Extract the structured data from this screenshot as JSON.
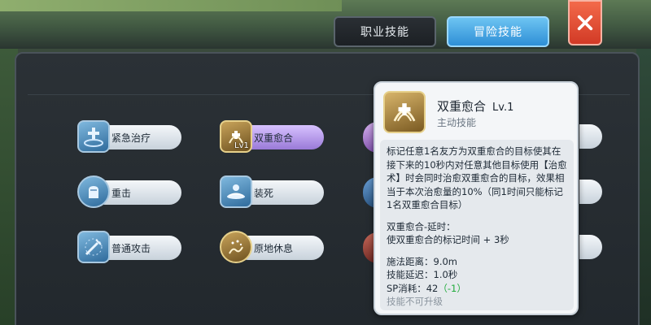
{
  "tabs": {
    "job": "职业技能",
    "adventure": "冒险技能"
  },
  "skills": [
    {
      "name": "紧急治疗",
      "icon": "shrine-icon"
    },
    {
      "name": "双重愈合",
      "icon": "double-heal-icon",
      "level": "Lv1",
      "selected": true
    },
    {
      "name": "重击",
      "icon": "fist-icon"
    },
    {
      "name": "装死",
      "icon": "play-dead-icon"
    },
    {
      "name": "普通攻击",
      "icon": "sword-icon"
    },
    {
      "name": "原地休息",
      "icon": "rest-icon"
    }
  ],
  "tooltip": {
    "title": "双重愈合",
    "level": "Lv.1",
    "type": "主动技能",
    "description": "标记任意1名友方为双重愈合的目标使其在接下来的10秒内对任意其他目标使用【治愈术】时会同时治愈双重愈合的目标，效果相当于本次治愈量的10%（同1时间只能标记1名双重愈合目标）",
    "delay_title": "双重愈合-延时：",
    "delay_text": "使双重愈合的标记时间 + 3秒",
    "range": "施法距离：9.0m",
    "cast_delay": "技能延迟：1.0秒",
    "sp_label": "SP消耗：42",
    "sp_delta": "（-1）",
    "footer": "技能不可升级"
  },
  "colors": {
    "tab_active": "#2e8fd6",
    "close_button": "#d23a26",
    "sp_delta": "#1faa3a"
  }
}
